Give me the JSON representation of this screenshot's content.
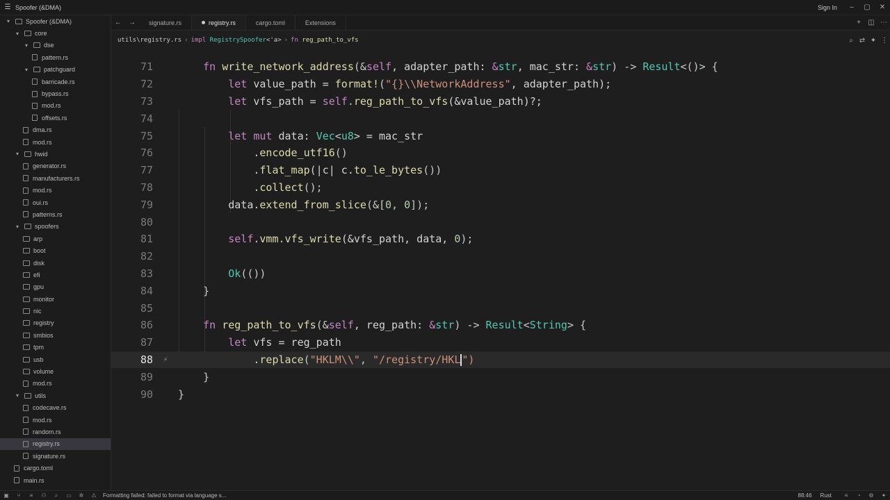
{
  "titlebar": {
    "title": "Spoofer (&DMA)",
    "signin": "Sign In"
  },
  "sidebar": {
    "items": [
      {
        "label": "Spoofer (&DMA)",
        "depth": 0,
        "kind": "folder"
      },
      {
        "label": "core",
        "depth": 1,
        "kind": "folder"
      },
      {
        "label": "dse",
        "depth": 2,
        "kind": "folder"
      },
      {
        "label": "pattern.rs",
        "depth": 3,
        "kind": "file"
      },
      {
        "label": "patchguard",
        "depth": 2,
        "kind": "folder"
      },
      {
        "label": "barricade.rs",
        "depth": 3,
        "kind": "file"
      },
      {
        "label": "bypass.rs",
        "depth": 3,
        "kind": "file"
      },
      {
        "label": "mod.rs",
        "depth": 3,
        "kind": "file"
      },
      {
        "label": "offsets.rs",
        "depth": 3,
        "kind": "file"
      },
      {
        "label": "dma.rs",
        "depth": 2,
        "kind": "file"
      },
      {
        "label": "mod.rs",
        "depth": 2,
        "kind": "file"
      },
      {
        "label": "hwid",
        "depth": 1,
        "kind": "folder"
      },
      {
        "label": "generator.rs",
        "depth": 2,
        "kind": "file"
      },
      {
        "label": "manufacturers.rs",
        "depth": 2,
        "kind": "file"
      },
      {
        "label": "mod.rs",
        "depth": 2,
        "kind": "file"
      },
      {
        "label": "oui.rs",
        "depth": 2,
        "kind": "file"
      },
      {
        "label": "patterns.rs",
        "depth": 2,
        "kind": "file"
      },
      {
        "label": "spoofers",
        "depth": 1,
        "kind": "folder"
      },
      {
        "label": "arp",
        "depth": 2,
        "kind": "closed"
      },
      {
        "label": "boot",
        "depth": 2,
        "kind": "closed"
      },
      {
        "label": "disk",
        "depth": 2,
        "kind": "closed"
      },
      {
        "label": "efi",
        "depth": 2,
        "kind": "closed"
      },
      {
        "label": "gpu",
        "depth": 2,
        "kind": "closed"
      },
      {
        "label": "monitor",
        "depth": 2,
        "kind": "closed"
      },
      {
        "label": "nic",
        "depth": 2,
        "kind": "closed"
      },
      {
        "label": "registry",
        "depth": 2,
        "kind": "closed"
      },
      {
        "label": "smbios",
        "depth": 2,
        "kind": "closed"
      },
      {
        "label": "tpm",
        "depth": 2,
        "kind": "closed"
      },
      {
        "label": "usb",
        "depth": 2,
        "kind": "closed"
      },
      {
        "label": "volume",
        "depth": 2,
        "kind": "closed"
      },
      {
        "label": "mod.rs",
        "depth": 2,
        "kind": "file"
      },
      {
        "label": "utils",
        "depth": 1,
        "kind": "folder"
      },
      {
        "label": "codecave.rs",
        "depth": 2,
        "kind": "file"
      },
      {
        "label": "mod.rs",
        "depth": 2,
        "kind": "file"
      },
      {
        "label": "random.rs",
        "depth": 2,
        "kind": "file"
      },
      {
        "label": "registry.rs",
        "depth": 2,
        "kind": "file",
        "active": true
      },
      {
        "label": "signature.rs",
        "depth": 2,
        "kind": "file"
      },
      {
        "label": "cargo.toml",
        "depth": 1,
        "kind": "file"
      },
      {
        "label": "main.rs",
        "depth": 1,
        "kind": "file"
      }
    ]
  },
  "tabs": [
    {
      "label": "signature.rs",
      "active": false
    },
    {
      "label": "registry.rs",
      "active": true
    },
    {
      "label": "cargo.toml",
      "active": false
    },
    {
      "label": "Extensions",
      "active": false
    }
  ],
  "breadcrumb": {
    "path": "utils\\registry.rs",
    "impl_kw": "impl",
    "impl_type": "RegistrySpoofer",
    "impl_generic": "<'a>",
    "fn_kw": "fn",
    "fn_name": "reg_path_to_vfs"
  },
  "editor": {
    "current_line": 88,
    "lines": [
      {
        "n": "71",
        "tokens": [
          [
            "    ",
            "v"
          ],
          [
            "fn ",
            "k"
          ],
          [
            "write_network_address",
            "f"
          ],
          [
            "(&",
            "p"
          ],
          [
            "self",
            "k"
          ],
          [
            ", adapter_path: ",
            "v"
          ],
          [
            "&",
            "k"
          ],
          [
            "str",
            "t"
          ],
          [
            ", mac_str: ",
            "v"
          ],
          [
            "&",
            "k"
          ],
          [
            "str",
            "t"
          ],
          [
            ") -> ",
            "p"
          ],
          [
            "Result",
            "t"
          ],
          [
            "<()> {",
            "p"
          ]
        ]
      },
      {
        "n": "72",
        "tokens": [
          [
            "        ",
            "v"
          ],
          [
            "let ",
            "k"
          ],
          [
            "value_path = ",
            "v"
          ],
          [
            "format!",
            "m"
          ],
          [
            "(",
            "p"
          ],
          [
            "\"{}\\\\NetworkAddress\"",
            "s"
          ],
          [
            ", adapter_path);",
            "v"
          ]
        ]
      },
      {
        "n": "73",
        "tokens": [
          [
            "        ",
            "v"
          ],
          [
            "let ",
            "k"
          ],
          [
            "vfs_path = ",
            "v"
          ],
          [
            "self",
            "k"
          ],
          [
            ".",
            "p"
          ],
          [
            "reg_path_to_vfs",
            "f"
          ],
          [
            "(&value_path)?;",
            "v"
          ]
        ]
      },
      {
        "n": "74",
        "tokens": []
      },
      {
        "n": "75",
        "tokens": [
          [
            "        ",
            "v"
          ],
          [
            "let mut ",
            "k"
          ],
          [
            "data: ",
            "v"
          ],
          [
            "Vec",
            "t"
          ],
          [
            "<",
            "p"
          ],
          [
            "u8",
            "t"
          ],
          [
            "> = mac_str",
            "v"
          ]
        ]
      },
      {
        "n": "76",
        "tokens": [
          [
            "            .",
            "v"
          ],
          [
            "encode_utf16",
            "f"
          ],
          [
            "()",
            "p"
          ]
        ]
      },
      {
        "n": "77",
        "tokens": [
          [
            "            .",
            "v"
          ],
          [
            "flat_map",
            "f"
          ],
          [
            "(|c| c.",
            "v"
          ],
          [
            "to_le_bytes",
            "f"
          ],
          [
            "())",
            "p"
          ]
        ]
      },
      {
        "n": "78",
        "tokens": [
          [
            "            .",
            "v"
          ],
          [
            "collect",
            "f"
          ],
          [
            "();",
            "p"
          ]
        ]
      },
      {
        "n": "79",
        "tokens": [
          [
            "        data.",
            "v"
          ],
          [
            "extend_from_slice",
            "f"
          ],
          [
            "(&[",
            "p"
          ],
          [
            "0",
            "n"
          ],
          [
            ", ",
            "p"
          ],
          [
            "0",
            "n"
          ],
          [
            "]);",
            "p"
          ]
        ]
      },
      {
        "n": "80",
        "tokens": []
      },
      {
        "n": "81",
        "tokens": [
          [
            "        ",
            "v"
          ],
          [
            "self",
            "k"
          ],
          [
            ".",
            "p"
          ],
          [
            "vmm",
            "f"
          ],
          [
            ".",
            "p"
          ],
          [
            "vfs_write",
            "f"
          ],
          [
            "(&vfs_path, data, ",
            "v"
          ],
          [
            "0",
            "n"
          ],
          [
            ");",
            "p"
          ]
        ]
      },
      {
        "n": "82",
        "tokens": []
      },
      {
        "n": "83",
        "tokens": [
          [
            "        ",
            "v"
          ],
          [
            "Ok",
            "t"
          ],
          [
            "(())",
            "p"
          ]
        ]
      },
      {
        "n": "84",
        "tokens": [
          [
            "    }",
            "p"
          ]
        ]
      },
      {
        "n": "85",
        "tokens": []
      },
      {
        "n": "86",
        "tokens": [
          [
            "    ",
            "v"
          ],
          [
            "fn ",
            "k"
          ],
          [
            "reg_path_to_vfs",
            "f"
          ],
          [
            "(&",
            "p"
          ],
          [
            "self",
            "k"
          ],
          [
            ", reg_path: ",
            "v"
          ],
          [
            "&",
            "k"
          ],
          [
            "str",
            "t"
          ],
          [
            ") -> ",
            "p"
          ],
          [
            "Result",
            "t"
          ],
          [
            "<",
            "p"
          ],
          [
            "String",
            "t"
          ],
          [
            "> {",
            "p"
          ]
        ]
      },
      {
        "n": "87",
        "tokens": [
          [
            "        ",
            "v"
          ],
          [
            "let ",
            "k"
          ],
          [
            "vfs = reg_path",
            "v"
          ]
        ]
      },
      {
        "n": "88",
        "tokens": [
          [
            "            .",
            "v"
          ],
          [
            "replace",
            "f"
          ],
          [
            "(",
            "p"
          ],
          [
            "\"HKLM\\\\\"",
            "s"
          ],
          [
            ", ",
            "p"
          ],
          [
            "\"/registry/HKL",
            "s"
          ],
          [
            "|caret|",
            "caret"
          ],
          [
            "\")",
            "s"
          ]
        ]
      },
      {
        "n": "89",
        "tokens": [
          [
            "    }",
            "p"
          ]
        ]
      },
      {
        "n": "90",
        "tokens": [
          [
            "}",
            "p"
          ]
        ]
      }
    ]
  },
  "statusbar": {
    "message": "Formatting failed: failed to format via language s...",
    "position": "88:46",
    "language": "Rust"
  },
  "icons": {
    "menu": "menu-icon",
    "back": "back-arrow-icon",
    "forward": "forward-arrow-icon",
    "search": "search-icon",
    "warning": "warning-icon"
  }
}
